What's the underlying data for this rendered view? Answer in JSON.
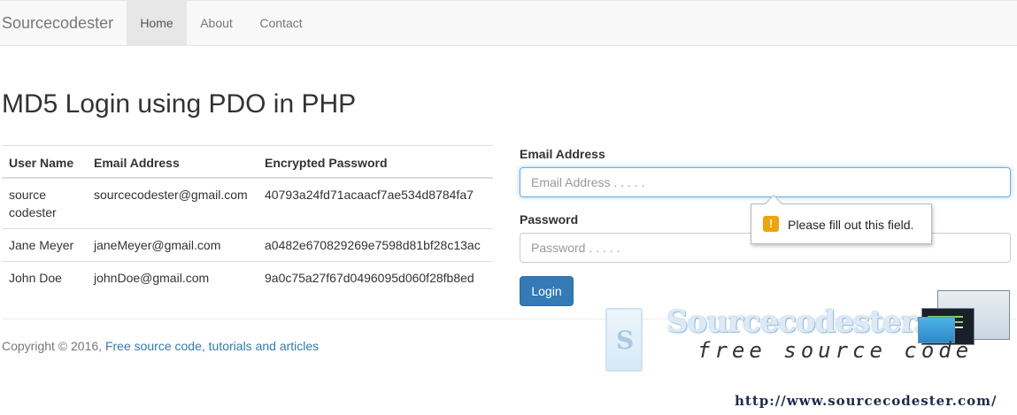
{
  "navbar": {
    "brand": "Sourcecodester",
    "items": [
      {
        "label": "Home",
        "active": true
      },
      {
        "label": "About",
        "active": false
      },
      {
        "label": "Contact",
        "active": false
      }
    ]
  },
  "page_title": "MD5 Login using PDO in PHP",
  "table": {
    "headers": [
      "User Name",
      "Email Address",
      "Encrypted Password"
    ],
    "rows": [
      [
        "source codester",
        "sourcecodester@gmail.com",
        "40793a24fd71acaacf7ae534d8784fa7"
      ],
      [
        "Jane Meyer",
        "janeMeyer@gmail.com",
        "a0482e670829269e7598d81bf28c13ac"
      ],
      [
        "John Doe",
        "johnDoe@gmail.com",
        "9a0c75a27f67d0496095d060f28fb8ed"
      ]
    ]
  },
  "form": {
    "email_label": "Email Address",
    "email_placeholder": "Email Address . . . . .",
    "email_value": "",
    "password_label": "Password",
    "password_placeholder": "Password . . . . .",
    "password_value": "",
    "login_button": "Login"
  },
  "validation_tooltip": {
    "icon": "warning-icon",
    "message": "Please fill out this field."
  },
  "footer": {
    "copyright": "Copyright © 2016, ",
    "link_text": "Free source code, tutorials and articles"
  },
  "watermark": {
    "title": "Sourcecodester.com",
    "subtitle": "free source code",
    "url": "http://www.sourcecodester.com/"
  },
  "colors": {
    "primary": "#337ab7",
    "navbar_bg": "#f8f8f8",
    "warning": "#f0a30a"
  }
}
